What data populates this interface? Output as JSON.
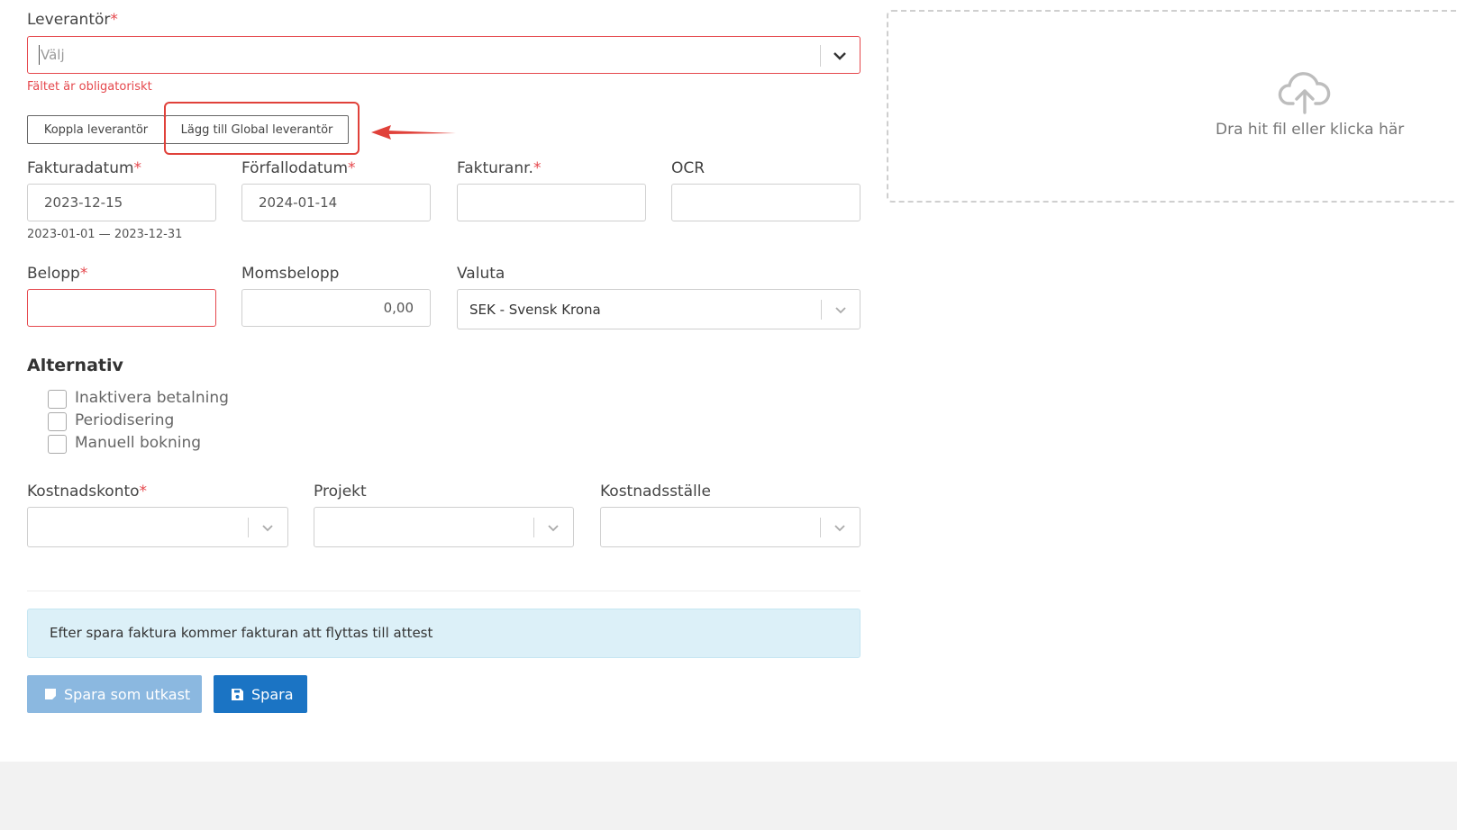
{
  "supplier": {
    "label": "Leverantör",
    "required_mark": "*",
    "placeholder": "Välj",
    "error": "Fältet är obligatoriskt",
    "connect_button": "Koppla leverantör",
    "add_global_button": "Lägg till Global leverantör"
  },
  "upload": {
    "text": "Dra hit fil eller klicka här"
  },
  "invoice_date": {
    "label": "Fakturadatum",
    "required_mark": "*",
    "value": "2023-12-15",
    "hint": "2023-01-01 — 2023-12-31"
  },
  "due_date": {
    "label": "Förfallodatum",
    "required_mark": "*",
    "value": "2024-01-14"
  },
  "invoice_no": {
    "label": "Fakturanr.",
    "required_mark": "*",
    "value": ""
  },
  "ocr": {
    "label": "OCR",
    "value": ""
  },
  "amount": {
    "label": "Belopp",
    "required_mark": "*",
    "value": ""
  },
  "vat_amount": {
    "label": "Momsbelopp",
    "value": "0,00"
  },
  "currency": {
    "label": "Valuta",
    "value": "SEK - Svensk Krona"
  },
  "options": {
    "heading": "Alternativ",
    "items": [
      {
        "label": "Inaktivera betalning",
        "checked": false
      },
      {
        "label": "Periodisering",
        "checked": false
      },
      {
        "label": "Manuell bokning",
        "checked": false
      }
    ]
  },
  "cost_account": {
    "label": "Kostnadskonto",
    "required_mark": "*",
    "value": ""
  },
  "project": {
    "label": "Projekt",
    "value": ""
  },
  "cost_center": {
    "label": "Kostnadsställe",
    "value": ""
  },
  "info": {
    "text": "Efter spara faktura kommer fakturan att flyttas till attest"
  },
  "actions": {
    "save_draft": "Spara som utkast",
    "save": "Spara"
  },
  "colors": {
    "error": "#e5484d",
    "primary": "#1b74c4",
    "primary_disabled": "#8bb8e0",
    "info_bg": "#dcf0f8",
    "highlight": "#e0413a"
  }
}
